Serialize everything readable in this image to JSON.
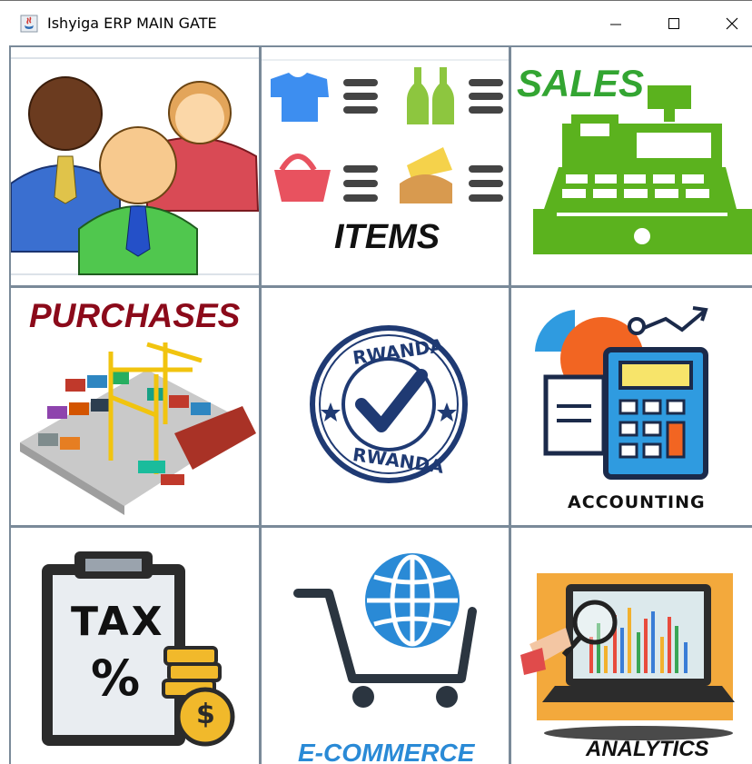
{
  "window": {
    "title": "Ishyiga ERP MAIN GATE",
    "minimize_icon": "minimize-icon",
    "maximize_icon": "maximize-icon",
    "close_icon": "close-icon"
  },
  "tiles": {
    "users": {
      "icon": "users-icon"
    },
    "items": {
      "label": "ITEMS",
      "icon": "items-icon"
    },
    "sales": {
      "label": "SALES",
      "icon": "cash-register-icon",
      "color": "#33a532"
    },
    "purchases": {
      "label": "PURCHASES",
      "icon": "port-icon",
      "color": "#8b0a1a"
    },
    "rwanda": {
      "stamp_text_top": "RWANDA",
      "stamp_text_bottom": "RWANDA",
      "icon": "rwanda-stamp-icon",
      "color": "#1f3a73"
    },
    "accounting": {
      "label": "ACCOUNTING",
      "icon": "calculator-icon"
    },
    "tax": {
      "text": "TAX",
      "percent": "%",
      "icon": "tax-clipboard-icon"
    },
    "ecommerce": {
      "label": "E-COMMERCE",
      "icon": "shopping-cart-globe-icon",
      "color": "#2a8ad6"
    },
    "analytics": {
      "label": "ANALYTICS",
      "icon": "analytics-screen-icon"
    }
  }
}
